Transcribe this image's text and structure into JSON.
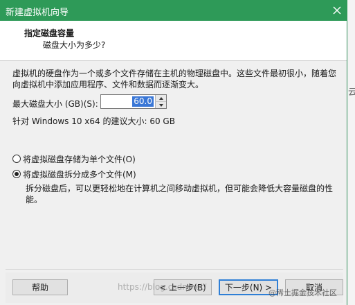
{
  "window": {
    "title": "新建虚拟机向导"
  },
  "header": {
    "title": "指定磁盘容量",
    "subtitle": "磁盘大小为多少?"
  },
  "description": "虚拟机的硬盘作为一个或多个文件存储在主机的物理磁盘中。这些文件最初很小，随着您向虚拟机中添加应用程序、文件和数据而逐渐变大。",
  "disk_size": {
    "label": "最大磁盘大小 (GB)(S):",
    "value": "60.0"
  },
  "recommended": "针对 Windows 10 x64 的建议大小: 60 GB",
  "options": [
    {
      "label": "将虚拟磁盘存储为单个文件(O)",
      "selected": false
    },
    {
      "label": "将虚拟磁盘拆分成多个文件(M)",
      "selected": true
    }
  ],
  "split_description": "拆分磁盘后，可以更轻松地在计算机之间移动虚拟机，但可能会降低大容量磁盘的性能。",
  "buttons": {
    "help": "帮助",
    "back": "< 上一步(B)",
    "next": "下一步(N) >",
    "cancel": "取消"
  },
  "watermark": {
    "url": "https://blog.csdn.net/",
    "site": "@稀土掘金技术社区"
  },
  "backdrop_char": "云",
  "colors": {
    "titlebar": "#2e9a58",
    "selection": "#3a77d6",
    "primary_border": "#2f7fd6"
  }
}
